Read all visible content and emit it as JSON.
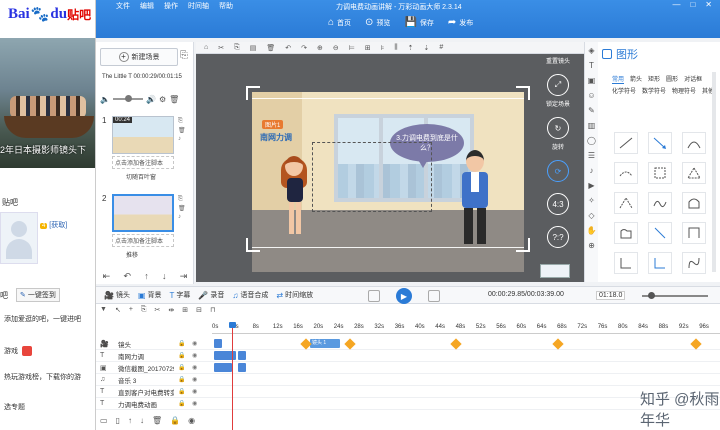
{
  "tieba": {
    "logo_b": "Bai",
    "logo_paw": "🐾",
    "logo_du": "du",
    "logo_tieba": "贴吧",
    "banner_caption": "2年日本摄影师镜头下",
    "section_title": "贴吧",
    "level_badge": "4",
    "get_link": "[获取]",
    "ba_label": "吧",
    "sign_button": "一键签到",
    "line_add": "添加爱逛的吧，一键进吧",
    "line_game": "游戏",
    "line_hot": "热玩游戏榜，下载你的游",
    "line_topic": "选专题"
  },
  "app": {
    "title": "力调电费动画讲解 - 万彩动画大师 2.3.14",
    "menus": [
      "文件",
      "编辑",
      "操作",
      "时间轴",
      "帮助"
    ],
    "winctl": [
      "—",
      "□",
      "✕"
    ],
    "toolbar": [
      {
        "icon": "⌂",
        "label": "首页"
      },
      {
        "icon": "⊙",
        "label": "预览"
      },
      {
        "icon": "💾",
        "label": "保存"
      },
      {
        "icon": "➦",
        "label": "发布"
      }
    ]
  },
  "scenes": {
    "new_scene": "新建场景",
    "timecode": "The Little T  00:00:29/00:01:15",
    "cards": [
      {
        "num": "1",
        "tag": "00:24",
        "note": "点击添加备注脚本",
        "name": "切随百叶窗"
      },
      {
        "num": "2",
        "tag": "",
        "note": "点击添加备注脚本",
        "name": "推移"
      }
    ]
  },
  "stage": {
    "badge": "图片1",
    "title_text": "南网力调",
    "bubble": "3.力调电费到底是什么？"
  },
  "camera_tools": {
    "top_label": "重置镜头",
    "fixed_label": "锁定场景",
    "rotate_label": "旋转",
    "ratio_a": "4:3",
    "ratio_b": "?:?"
  },
  "shapes": {
    "header": "图形",
    "tabs": [
      "常用",
      "箭头",
      "矩形",
      "圆形",
      "对话框",
      "化学符号",
      "数学符号",
      "物理符号",
      "其他"
    ],
    "active_tab": "常用"
  },
  "timeline_toolbar": {
    "items": [
      {
        "icon": "🎥",
        "label": "镜头"
      },
      {
        "icon": "▣",
        "label": "背景"
      },
      {
        "icon": "T",
        "label": "字幕"
      },
      {
        "icon": "🎤",
        "label": "录音"
      },
      {
        "icon": "♫",
        "label": "语音合成"
      },
      {
        "icon": "⇄",
        "label": "时间缩放"
      }
    ],
    "timecode": "00:00:29.85/00:03:39.00",
    "zoom": "01:18.0"
  },
  "timeline": {
    "ticks": [
      "0s",
      "4s",
      "8s",
      "12s",
      "16s",
      "20s",
      "24s",
      "28s",
      "32s",
      "36s",
      "40s",
      "44s",
      "48s",
      "52s",
      "56s",
      "60s",
      "64s",
      "68s",
      "72s",
      "76s",
      "80s",
      "84s",
      "88s",
      "92s",
      "96s"
    ],
    "tracks": [
      {
        "icon": "🎥",
        "label": "镜头"
      },
      {
        "icon": "T",
        "label": "南网力调"
      },
      {
        "icon": "▣",
        "label": "微信截图_201707291"
      },
      {
        "icon": "♫",
        "label": "音乐 3"
      },
      {
        "icon": "T",
        "label": "直到客户对电费转变"
      },
      {
        "icon": "T",
        "label": "力调电费动画"
      }
    ],
    "camera_block_label": "镜头 1"
  },
  "watermark": {
    "text": "知乎 @秋雨年华"
  }
}
